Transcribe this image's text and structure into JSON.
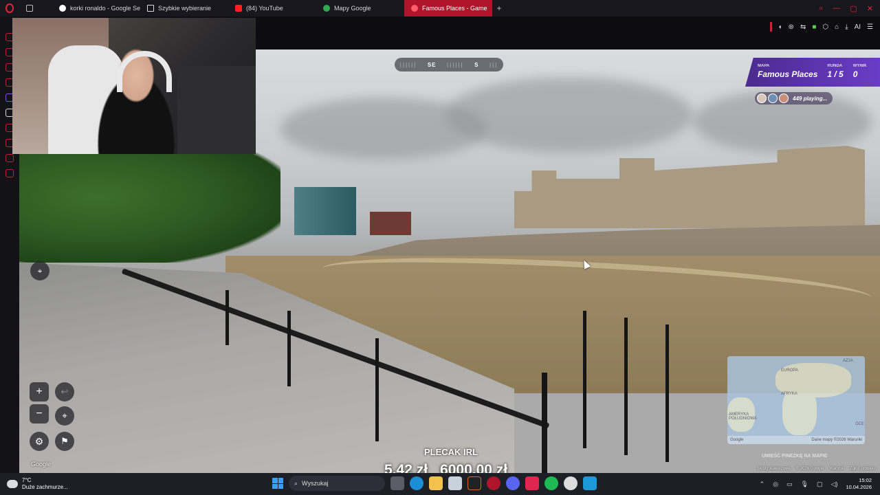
{
  "browser": {
    "tabs": [
      {
        "label": "korki ronaldo - Google Se",
        "favicon": "google-icon",
        "active": false
      },
      {
        "label": "Szybkie wybieranie",
        "favicon": "speed-dial-icon",
        "active": false
      },
      {
        "label": "(84) YouTube",
        "favicon": "youtube-icon",
        "active": false
      },
      {
        "label": "Mapy Google",
        "favicon": "maps-pin-icon",
        "active": false
      },
      {
        "label": "Famous Places - Game",
        "favicon": "maps-pin-icon",
        "active": true
      }
    ],
    "new_tab": "+",
    "toolbar_ai": "AI"
  },
  "game": {
    "compass": {
      "left": "SE",
      "right": "S"
    },
    "map_label": "MAPA",
    "map_value": "Famous Places",
    "round_label": "RUNDA",
    "round_value": "1 / 5",
    "score_label": "WYNIK",
    "score_value": "0",
    "playing": "449 playing..."
  },
  "streetview": {
    "zoom_in": "+",
    "zoom_out": "−",
    "google": "Google",
    "footer": [
      "Skróty klawiszowe",
      "© 2026 Google",
      "Warunki",
      "Zgłoś problem"
    ],
    "minimap": {
      "labels": [
        "EUROPA",
        "AFRYKA",
        "AMERYKA POŁUDNIOWA",
        "AZJA",
        "OCE"
      ],
      "footer_left": "Google",
      "footer_right": "Dane mapy ©2026   Warunki",
      "hint": "UMIEŚĆ PINEZKĘ NA MAPIE"
    }
  },
  "stream": {
    "title": "PLECAK IRL",
    "amount_left": "5,42 zł",
    "amount_right": "6000,00 zł"
  },
  "taskbar": {
    "weather_temp": "7°C",
    "weather_desc": "Duże zachmurze...",
    "search_placeholder": "Wyszukaj",
    "time": "15:02",
    "date": "10.04.2026"
  },
  "colors": {
    "accent": "#e0263a",
    "hud_purple": "#5a33a8",
    "taskbar": "#1d1f26"
  }
}
